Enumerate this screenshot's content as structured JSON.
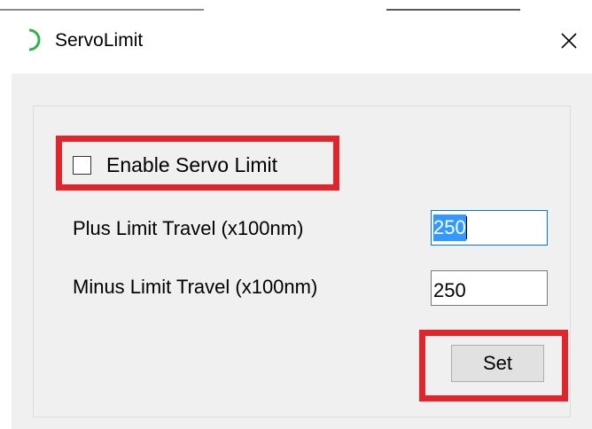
{
  "window": {
    "title": "ServoLimit",
    "close_glyph": "✕",
    "icon": "spinner-arc-icon",
    "accent_color": "#2fb34a"
  },
  "form": {
    "enable_label": "Enable Servo Limit",
    "enable_checked": false,
    "plus_label": "Plus Limit Travel (x100nm)",
    "plus_value": "250",
    "minus_label": "Minus Limit Travel (x100nm)",
    "minus_value": "250",
    "set_label": "Set"
  },
  "annotations": {
    "highlight_color": "#e3242b"
  }
}
